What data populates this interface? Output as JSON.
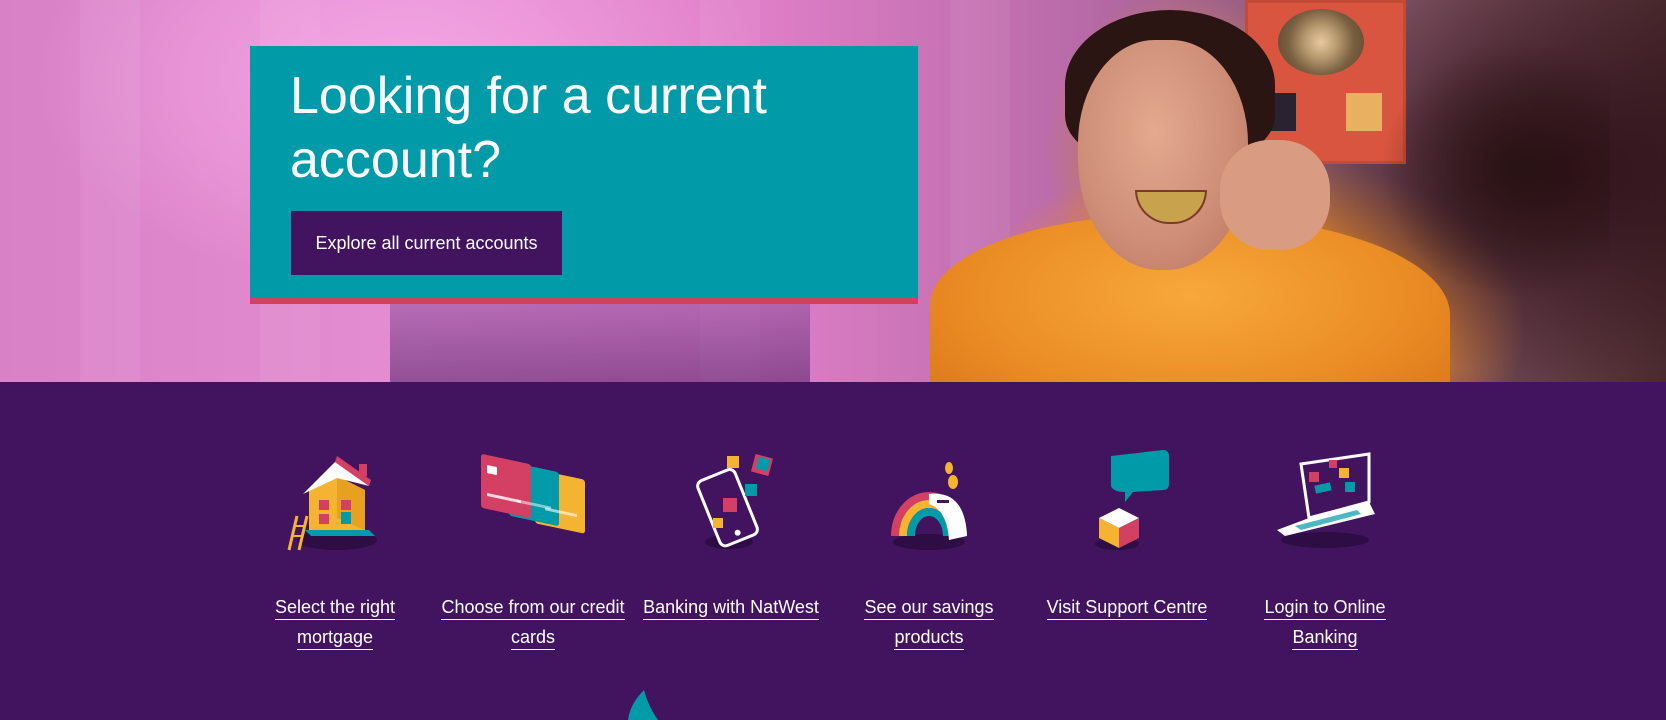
{
  "hero": {
    "title": "Looking for a current account?",
    "cta_label": "Explore all current accounts"
  },
  "features": [
    {
      "label": "Select the right mortgage",
      "icon": "house-icon"
    },
    {
      "label": "Choose from our credit cards",
      "icon": "credit-cards-icon"
    },
    {
      "label": "Banking with NatWest",
      "icon": "mobile-phone-icon"
    },
    {
      "label": "See our savings products",
      "icon": "rainbow-piggy-bank-icon"
    },
    {
      "label": "Visit Support Centre",
      "icon": "chat-bubble-icon"
    },
    {
      "label": "Login to Online Banking",
      "icon": "laptop-icon"
    }
  ],
  "colors": {
    "brand_purple": "#42145f",
    "teal": "#009aa8",
    "pink_accent": "#d44064"
  }
}
